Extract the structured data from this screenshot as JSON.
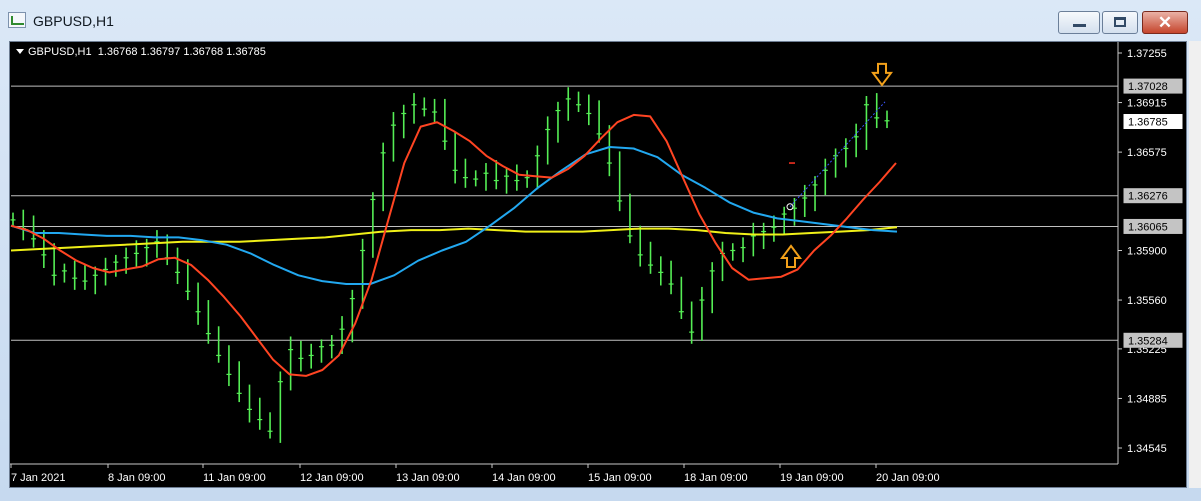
{
  "window": {
    "title": "GBPUSD,H1",
    "close_glyph": "✕"
  },
  "header": {
    "symbol": "GBPUSD,H1",
    "ohlc": "1.36768 1.36797 1.36768 1.36785"
  },
  "colors": {
    "background": "#000000",
    "candles": "#55ee55",
    "ma_fast": "#ff4422",
    "ma_mid": "#22a8f0",
    "ma_slow": "#f0f018",
    "arrows": "#f2a01a",
    "hlines": "#c0c0c0"
  },
  "chart_data": {
    "type": "line",
    "symbol": "GBPUSD",
    "timeframe": "H1",
    "x_ticks": [
      "7 Jan 2021",
      "8 Jan 09:00",
      "11 Jan 09:00",
      "12 Jan 09:00",
      "13 Jan 09:00",
      "14 Jan 09:00",
      "15 Jan 09:00",
      "18 Jan 09:00",
      "19 Jan 09:00",
      "20 Jan 09:00"
    ],
    "y_ticks": [
      "1.37255",
      "1.36915",
      "1.36575",
      "1.35900",
      "1.35560",
      "1.35225",
      "1.34885",
      "1.34545"
    ],
    "ylim": [
      1.3433,
      1.374
    ],
    "horizontal_lines": [
      1.37028,
      1.36276,
      1.36065,
      1.35284
    ],
    "price_labels": [
      {
        "text": "1.37028",
        "value": 1.37028,
        "style": "gray"
      },
      {
        "text": "1.36785",
        "value": 1.36785,
        "style": "current"
      },
      {
        "text": "1.36276",
        "value": 1.36276,
        "style": "gray"
      },
      {
        "text": "1.36065",
        "value": 1.36065,
        "style": "gray"
      },
      {
        "text": "1.35284",
        "value": 1.35284,
        "style": "gray"
      }
    ],
    "close": [
      1.3611,
      1.3605,
      1.3598,
      1.3587,
      1.3573,
      1.3576,
      1.3571,
      1.3569,
      1.3573,
      1.3577,
      1.3582,
      1.3585,
      1.3588,
      1.3592,
      1.3596,
      1.3585,
      1.3575,
      1.3562,
      1.3548,
      1.3533,
      1.3518,
      1.3505,
      1.3492,
      1.3481,
      1.3474,
      1.3466,
      1.35,
      1.3522,
      1.3516,
      1.3518,
      1.3524,
      1.3525,
      1.3536,
      1.3557,
      1.359,
      1.3625,
      1.3657,
      1.3676,
      1.3684,
      1.369,
      1.3687,
      1.3685,
      1.3665,
      1.3645,
      1.364,
      1.3639,
      1.3643,
      1.3638,
      1.3641,
      1.3638,
      1.364,
      1.3655,
      1.3673,
      1.3686,
      1.3694,
      1.369,
      1.3684,
      1.367,
      1.365,
      1.3624,
      1.36,
      1.3587,
      1.358,
      1.3575,
      1.3567,
      1.3548,
      1.3534,
      1.3556,
      1.3576,
      1.3588,
      1.359,
      1.3592,
      1.36,
      1.3603,
      1.3606,
      1.3615,
      1.3619,
      1.3626,
      1.3635,
      1.3645,
      1.3655,
      1.366,
      1.3668,
      1.369,
      1.3681,
      1.3679
    ],
    "ma_fast": [
      1.3607,
      1.3604,
      1.3598,
      1.359,
      1.3583,
      1.3578,
      1.3575,
      1.3577,
      1.3579,
      1.3584,
      1.3585,
      1.358,
      1.357,
      1.3558,
      1.3545,
      1.353,
      1.3515,
      1.3505,
      1.3504,
      1.3508,
      1.3518,
      1.354,
      1.357,
      1.361,
      1.365,
      1.3675,
      1.3678,
      1.3672,
      1.3665,
      1.3655,
      1.3648,
      1.3642,
      1.3641,
      1.364,
      1.3646,
      1.3655,
      1.3667,
      1.3678,
      1.3683,
      1.3682,
      1.3665,
      1.364,
      1.3615,
      1.3595,
      1.3578,
      1.357,
      1.3571,
      1.3572,
      1.3577,
      1.359,
      1.36,
      1.3612,
      1.3625,
      1.3637,
      1.365
    ],
    "ma_mid": [
      1.3607,
      1.3602,
      1.3602,
      1.3601,
      1.36,
      1.36,
      1.3599,
      1.3599,
      1.3597,
      1.3594,
      1.3588,
      1.358,
      1.3573,
      1.3569,
      1.3567,
      1.3567,
      1.3573,
      1.3583,
      1.359,
      1.3596,
      1.3607,
      1.3619,
      1.3633,
      1.3645,
      1.3656,
      1.3661,
      1.366,
      1.3654,
      1.3642,
      1.3633,
      1.3623,
      1.3616,
      1.3612,
      1.361,
      1.3608,
      1.3606,
      1.3604,
      1.3603
    ],
    "ma_slow": [
      1.359,
      1.3591,
      1.3592,
      1.3593,
      1.3594,
      1.3595,
      1.3596,
      1.3596,
      1.3596,
      1.3597,
      1.3598,
      1.3599,
      1.3601,
      1.3603,
      1.3604,
      1.3604,
      1.3605,
      1.3604,
      1.3603,
      1.3603,
      1.3603,
      1.3604,
      1.3605,
      1.3605,
      1.3604,
      1.3602,
      1.3601,
      1.3601,
      1.3602,
      1.3603,
      1.3604,
      1.3606
    ],
    "arrows": [
      {
        "direction": "down",
        "value": 1.3718
      },
      {
        "direction": "up",
        "value": 1.3589
      }
    ]
  }
}
